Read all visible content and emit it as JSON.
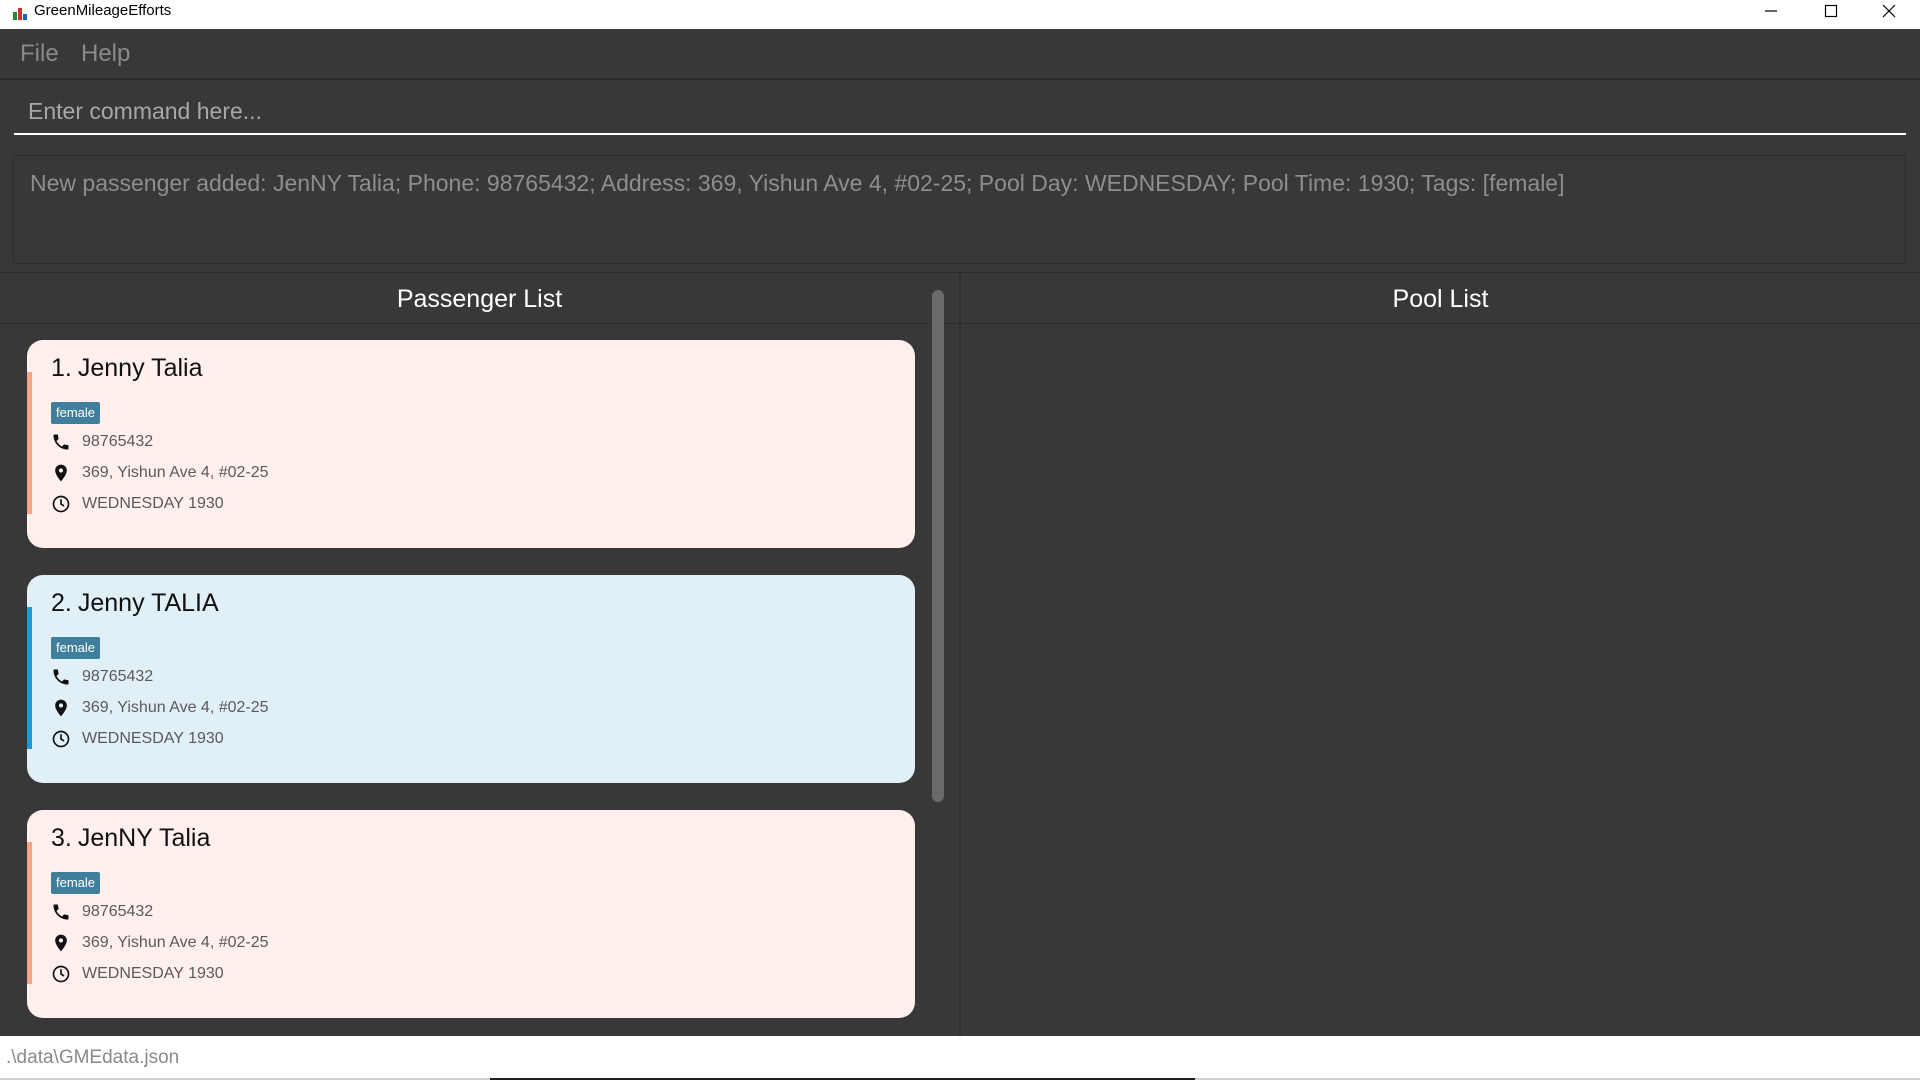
{
  "window": {
    "title": "GreenMileageEfforts"
  },
  "menu": {
    "file": "File",
    "help": "Help"
  },
  "command": {
    "placeholder": "Enter command here...",
    "value": ""
  },
  "result": {
    "text": "New passenger added: JenNY Talia; Phone: 98765432; Address: 369, Yishun Ave 4, #02-25; Pool Day: WEDNESDAY; Pool Time: 1930; Tags: [female]"
  },
  "panels": {
    "passenger_title": "Passenger List",
    "pool_title": "Pool List"
  },
  "passengers": [
    {
      "index": "1.",
      "name": "Jenny Talia",
      "tag": "female",
      "phone": "98765432",
      "address": "369, Yishun Ave 4, #02-25",
      "pool": "WEDNESDAY 1930",
      "color": "#ffefed"
    },
    {
      "index": "2.",
      "name": "Jenny TALIA",
      "tag": "female",
      "phone": "98765432",
      "address": "369, Yishun Ave 4, #02-25",
      "pool": "WEDNESDAY 1930",
      "color": "#e1f0f6"
    },
    {
      "index": "3.",
      "name": "JenNY Talia",
      "tag": "female",
      "phone": "98765432",
      "address": "369, Yishun Ave 4, #02-25",
      "pool": "WEDNESDAY 1930",
      "color": "#ffefed"
    }
  ],
  "status": {
    "path": ".\\data\\GMEdata.json"
  },
  "icons": {
    "phone": "phone-icon",
    "address": "map-pin-icon",
    "time": "clock-icon",
    "minimize": "minimize-icon",
    "maximize": "maximize-icon",
    "close": "close-icon"
  }
}
